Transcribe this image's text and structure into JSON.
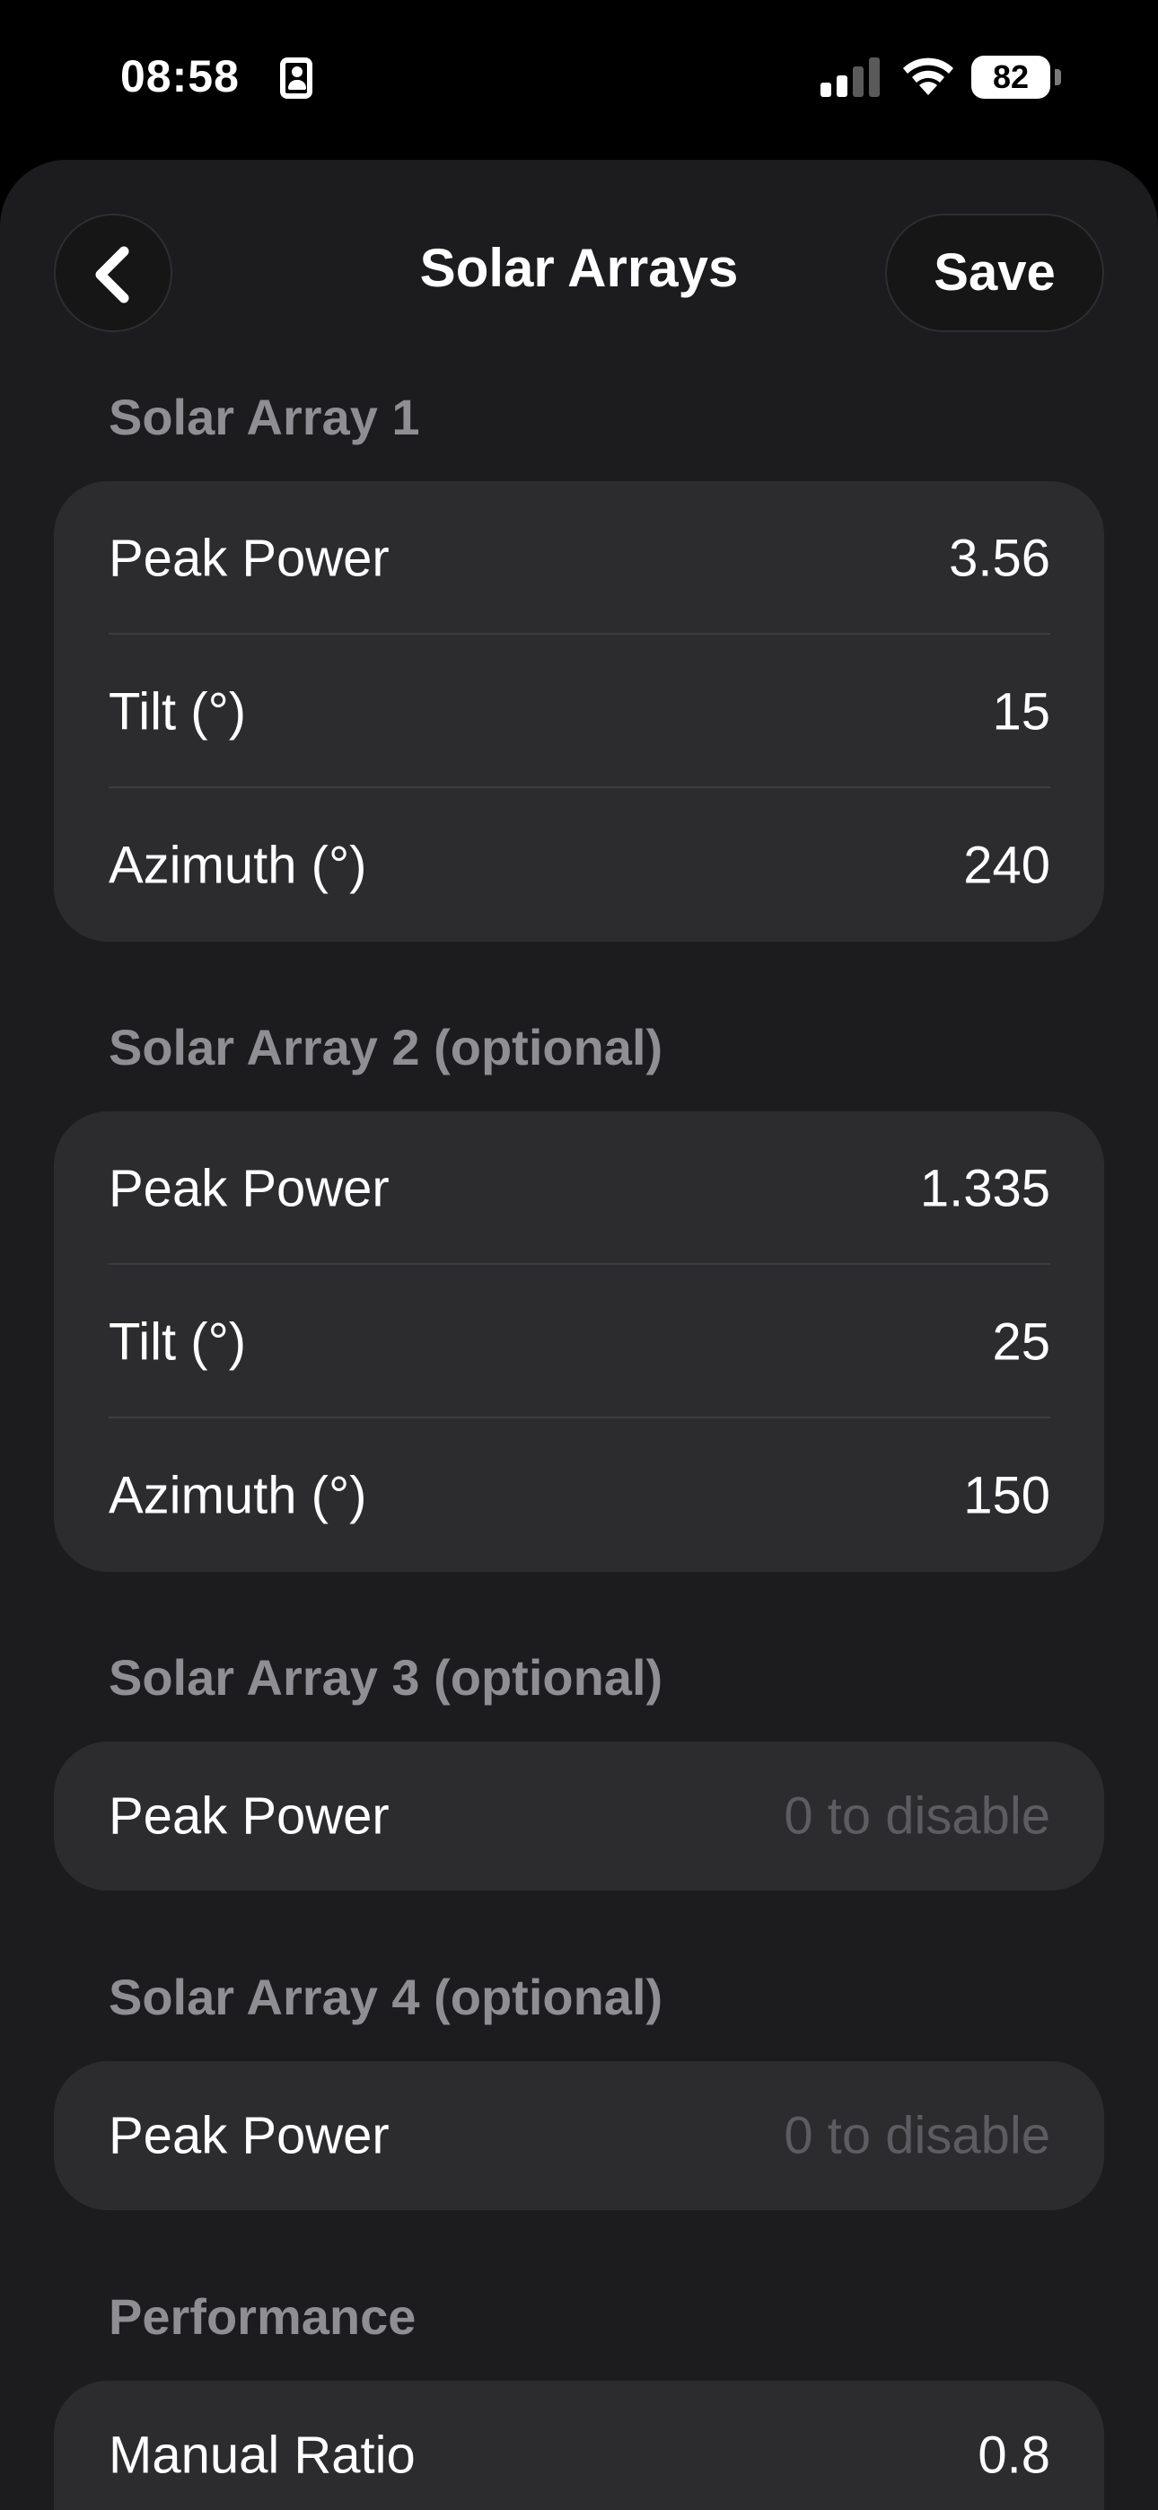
{
  "status_bar": {
    "time": "08:58",
    "battery": "82",
    "icons": [
      "id-card-icon",
      "cellular-signal-icon",
      "wifi-icon",
      "battery-icon"
    ]
  },
  "nav": {
    "back_icon": "chevron-left-icon",
    "title": "Solar Arrays",
    "save_label": "Save"
  },
  "sections": [
    {
      "header": "Solar Array 1",
      "rows": [
        {
          "label": "Peak Power",
          "value": "3.56"
        },
        {
          "label": "Tilt (°)",
          "value": "15"
        },
        {
          "label": "Azimuth (°)",
          "value": "240"
        }
      ]
    },
    {
      "header": "Solar Array 2 (optional)",
      "rows": [
        {
          "label": "Peak Power",
          "value": "1.335"
        },
        {
          "label": "Tilt (°)",
          "value": "25"
        },
        {
          "label": "Azimuth (°)",
          "value": "150"
        }
      ]
    },
    {
      "header": "Solar Array 3 (optional)",
      "rows": [
        {
          "label": "Peak Power",
          "value": "",
          "placeholder": "0 to disable"
        }
      ]
    },
    {
      "header": "Solar Array 4 (optional)",
      "rows": [
        {
          "label": "Peak Power",
          "value": "",
          "placeholder": "0 to disable"
        }
      ]
    },
    {
      "header": "Performance",
      "rows": [
        {
          "label": "Manual Ratio",
          "value": "0.8"
        }
      ]
    }
  ],
  "colors": {
    "background": "#000000",
    "sheet": "#1c1c1e",
    "card": "#2c2c2e",
    "section_header": "#8e8e93",
    "placeholder": "#5c5c61"
  }
}
